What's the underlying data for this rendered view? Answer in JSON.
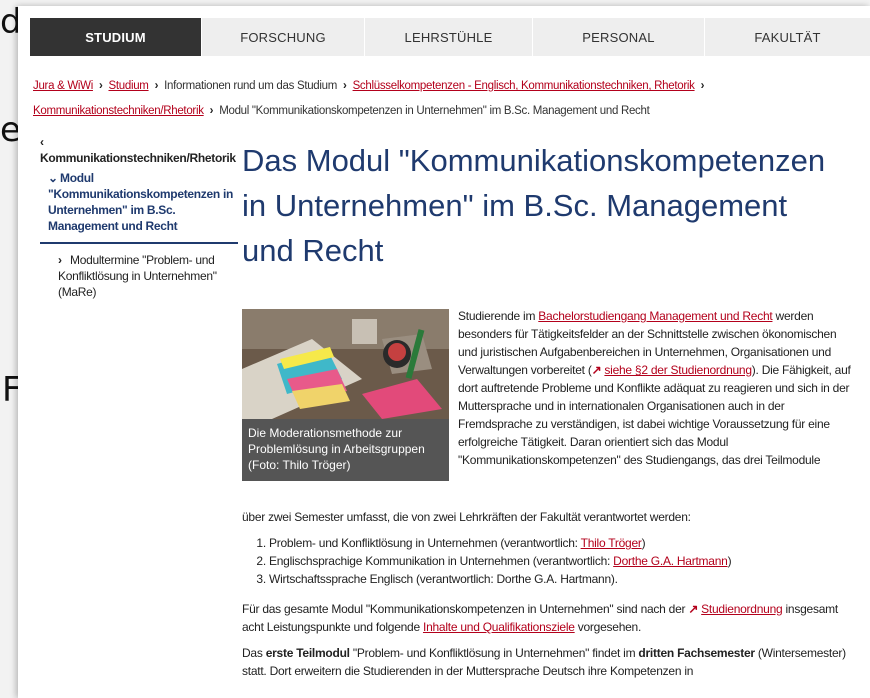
{
  "background": {
    "frag_1": "d",
    "frag_2": "e",
    "frag_3": "F"
  },
  "nav": {
    "items": [
      {
        "label": "STUDIUM",
        "active": true
      },
      {
        "label": "FORSCHUNG"
      },
      {
        "label": "LEHRSTÜHLE"
      },
      {
        "label": "PERSONAL"
      },
      {
        "label": "FAKULTÄT"
      }
    ]
  },
  "breadcrumb": {
    "crumb_1": "Jura & WiWi",
    "crumb_2": "Studium",
    "crumb_3": "Informationen rund um das Studium",
    "crumb_4": "Schlüsselkompetenzen - Englisch, Kommunikationstechniken, Rhetorik",
    "crumb_5": "Kommunikationstechniken/Rhetorik",
    "crumb_6": "Modul \"Kommunikationskompetenzen in Unternehmen\" im B.Sc. Management und Recht"
  },
  "sidebar": {
    "parent": "Kommunikationstechniken/Rhetorik",
    "current": "Modul \"Kommunikationskompetenzen in Unternehmen\" im B.Sc. Management und Recht",
    "child": "Modultermine \"Problem- und Konfliktlösung in Unternehmen\" (MaRe)"
  },
  "page": {
    "title": "Das Modul \"Kommunikationskompetenzen in Unternehmen\" im B.Sc. Management und Recht"
  },
  "figure": {
    "caption": "Die Moderationsmethode zur Problemlösung in Arbeitsgruppen (Foto: Thilo Tröger)"
  },
  "intro": {
    "t1": "Studierende im ",
    "link_bsc": "Bachelorstudiengang Management und Recht",
    "t2": " werden besonders für Tätigkeitsfelder an der Schnittstelle zwischen ökonomischen und juristischen Aufgabenbereichen in Unternehmen, Organisationen und Verwaltungen vorbereitet (",
    "link_sect2": "siehe §2 der Studienordnung",
    "t3": "). Die Fähigkeit, auf dort auftretende Probleme und Konflikte adäquat zu reagieren und sich in der Muttersprache und in internationalen Organisationen auch in der Fremdsprache zu verständigen, ist dabei wichtige Voraussetzung für eine erfolgreiche Tätigkeit. Daran orientiert sich das Modul \"Kommunikationskompetenzen\" des Studiengangs, das drei Teilmodule",
    "t4": "über zwei Semester umfasst, die von zwei Lehrkräften der Fakultät verantwortet werden:"
  },
  "list": {
    "i1_text": "Problem- und Konfliktlösung in Unternehmen (verantwortlich: ",
    "i1_link": "Thilo Tröger",
    "i2_text": "Englischsprachige Kommunikation in Unternehmen (verantwortlich: ",
    "i2_link": "Dorthe G.A. Hartmann",
    "i3_text": "Wirtschaftssprache Englisch (verantwortlich: Dorthe G.A. Hartmann).",
    "close": ")"
  },
  "para2": {
    "t1": "Für das gesamte Modul \"Kommunikationskompetenzen in Unternehmen\" sind nach der ",
    "link_so": "Studienordnung",
    "t2": " insgesamt acht Leistungspunkte und folgende ",
    "link_inhalte": "Inhalte und Qualifikationsziele",
    "t3": " vorgesehen."
  },
  "para3": {
    "t1": "Das ",
    "b1": "erste Teilmodul",
    "t2": " \"Problem- und Konfliktlösung in Unternehmen\" findet im ",
    "b2": "dritten Fachsemester",
    "t3": " (Wintersemester) statt. Dort erweitern die Studierenden in der Muttersprache Deutsch ihre Kompetenzen in"
  },
  "icons": {
    "external": "↗",
    "sep": "›"
  }
}
